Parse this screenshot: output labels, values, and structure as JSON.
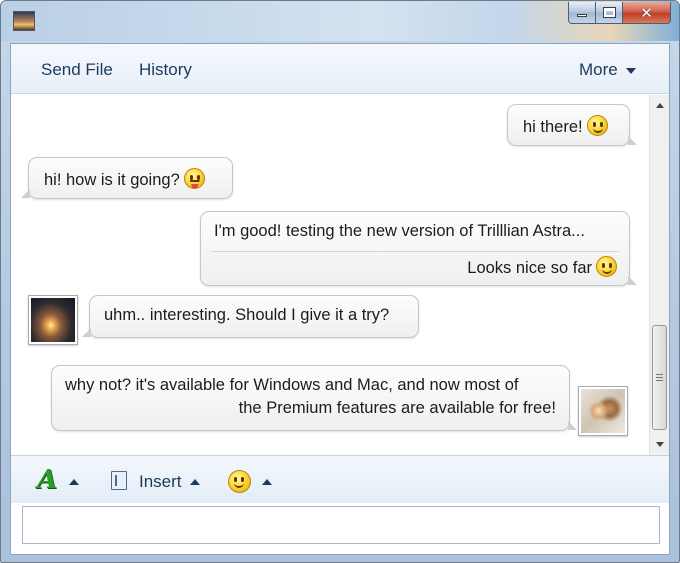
{
  "window": {
    "title": "",
    "colors": {
      "frame": "#b9cde3",
      "toolbar_text": "#1e3a5a",
      "accent_green": "#2f9b2f"
    }
  },
  "toolbar": {
    "send_file_label": "Send File",
    "history_label": "History",
    "more_label": "More"
  },
  "messages": [
    {
      "side": "right",
      "text": "hi there!",
      "emoticon": "smile-icon"
    },
    {
      "side": "left",
      "text": "hi! how is it going?",
      "emoticon": "tongue-icon"
    },
    {
      "side": "right",
      "line1": "I'm good! testing the new version of Trilllian Astra...",
      "line2": "Looks nice so far",
      "emoticon": "smile-icon"
    },
    {
      "side": "left",
      "text": "uhm.. interesting. Should I give it a try?",
      "avatar": "sunset-avatar"
    },
    {
      "side": "right",
      "line1": "why not? it's available for Windows and Mac, and now most of",
      "line2": "the Premium features are available for free!",
      "avatar": "cat-avatar"
    }
  ],
  "compose": {
    "font_icon_glyph": "A",
    "insert_label": "Insert",
    "input_value": ""
  }
}
